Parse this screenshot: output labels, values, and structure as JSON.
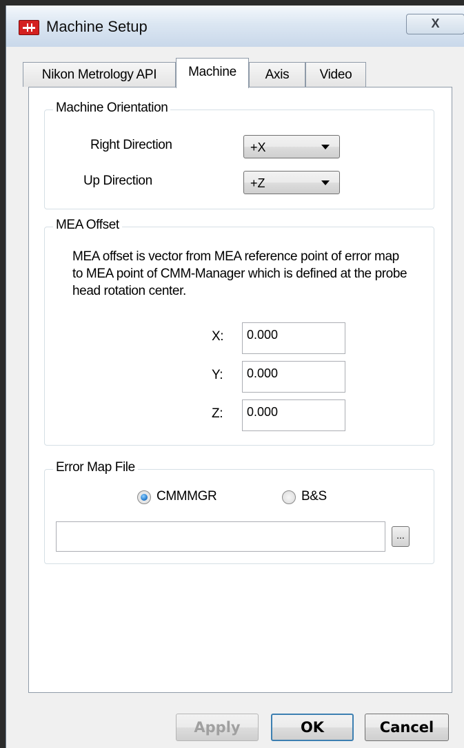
{
  "window": {
    "title": "Machine Setup",
    "close_label": "X"
  },
  "tabs": [
    {
      "label": "Nikon Metrology API"
    },
    {
      "label": "Machine",
      "active": true
    },
    {
      "label": "Axis"
    },
    {
      "label": "Video"
    }
  ],
  "orientation": {
    "legend": "Machine Orientation",
    "right_label": "Right Direction",
    "right_value": "+X",
    "up_label": "Up Direction",
    "up_value": "+Z"
  },
  "mea": {
    "legend": "MEA Offset",
    "description": "MEA offset is vector from MEA reference point of error map to MEA point of CMM-Manager which is defined at the probe head rotation center.",
    "x_label": "X:",
    "x_value": "0.000",
    "y_label": "Y:",
    "y_value": "0.000",
    "z_label": "Z:",
    "z_value": "0.000"
  },
  "error_map": {
    "legend": "Error Map File",
    "option_cmmmgr": "CMMMGR",
    "option_bs": "B&S",
    "selected": "CMMMGR",
    "path_value": "",
    "browse_label": "..."
  },
  "buttons": {
    "apply": "Apply",
    "ok": "OK",
    "cancel": "Cancel"
  },
  "colors": {
    "accent": "#2a7fd0",
    "app_icon": "#d42020"
  },
  "icons": {
    "app": "machine-setup-app-icon",
    "close": "close-icon",
    "dropdown": "chevron-down-icon"
  }
}
